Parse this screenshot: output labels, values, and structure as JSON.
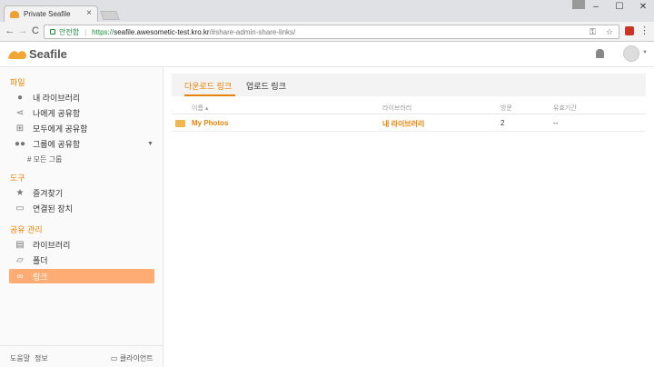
{
  "browser": {
    "tab_title": "Private Seafile",
    "tab_close": "×",
    "win_min": "–",
    "win_max": "☐",
    "win_close": "✕",
    "back": "←",
    "forward": "→",
    "reload": "C",
    "secure_label": "안전함",
    "url_scheme": "https://",
    "url_host": "seafile.awesometic-test.kro.kr",
    "url_path": "/#share-admin-share-links/",
    "menu": "⋮"
  },
  "header": {
    "logo_text": "Seafile"
  },
  "sidebar": {
    "files_title": "파일",
    "my_libraries": "내 라이브러리",
    "shared_with_me": "나에게 공유함",
    "shared_with_all": "모두에게 공유함",
    "shared_with_groups": "그룹에 공유함",
    "all_groups": "모든 그룹",
    "tools_title": "도구",
    "favorites": "즐겨찾기",
    "linked_devices": "연결된 장치",
    "share_admin_title": "공유 관리",
    "libraries": "라이브러리",
    "folders": "폴더",
    "links": "링크",
    "help": "도움말",
    "about": "정보",
    "clients": "클라이언트"
  },
  "main": {
    "tab_download": "다운로드 링크",
    "tab_upload": "업로드 링크",
    "col_name": "이름 ▴",
    "col_library": "라이브러리",
    "col_visits": "방문",
    "col_expiry": "유효기간",
    "rows": [
      {
        "name": "My Photos",
        "library": "내 라이브러리",
        "visits": "2",
        "expiry": "--"
      }
    ]
  },
  "colors": {
    "accent": "#eb8205",
    "active_bg": "#feac74"
  }
}
